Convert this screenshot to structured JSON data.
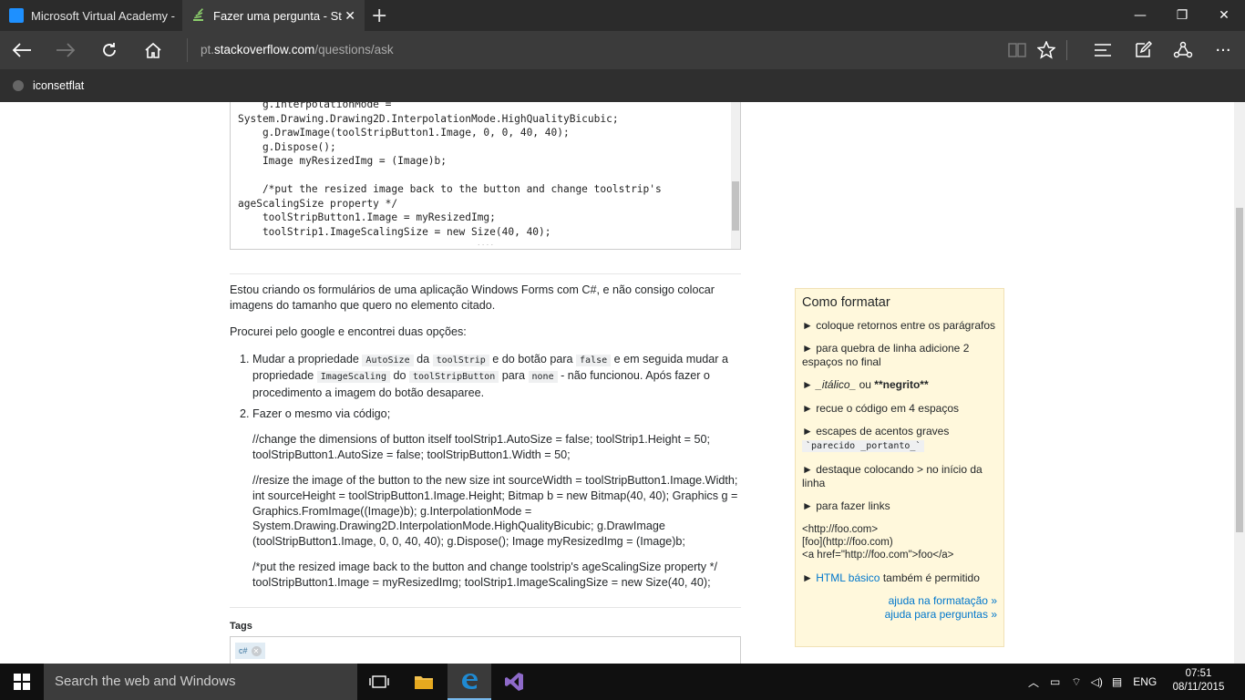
{
  "browser": {
    "tabs": [
      {
        "title": "Microsoft Virtual Academy -",
        "active": false
      },
      {
        "title": "Fazer uma pergunta - St",
        "active": true
      }
    ],
    "url_host": "pt.stackoverflow.com",
    "url_prefix": "pt.",
    "url_domain": "stackoverflow.com",
    "url_path": "/questions/ask",
    "favorites": [
      {
        "label": "iconsetflat"
      }
    ]
  },
  "editor": {
    "code_text": "    g.InterpolationMode = \nSystem.Drawing.Drawing2D.InterpolationMode.HighQualityBicubic;\n    g.DrawImage(toolStripButton1.Image, 0, 0, 40, 40);\n    g.Dispose();\n    Image myResizedImg = (Image)b;\n\n    /*put the resized image back to the button and change toolstrip's \nageScalingSize property */\n    toolStripButton1.Image = myResizedImg;\n    toolStrip1.ImageScalingSize = new Size(40, 40);"
  },
  "preview": {
    "para1": "Estou criando os formulários de uma aplicação Windows Forms com C#, e não consigo colocar imagens do tamanho que quero no elemento citado.",
    "para2": "Procurei pelo google e encontrei duas opções:",
    "item1": {
      "t1": "Mudar a propriedade ",
      "c1": "AutoSize",
      "t2": " da ",
      "c2": "toolStrip",
      "t3": " e do botão para ",
      "c3": "false",
      "t4": " e em seguida mudar a propriedade ",
      "c4": "ImageScaling",
      "t5": " do ",
      "c5": "toolStripButton",
      "t6": " para ",
      "c6": "none",
      "t7": " - não funcionou. Após fazer o procedimento a imagem do botão desaparee."
    },
    "item2": {
      "title": "Fazer o mesmo via código;",
      "p1": "//change the dimensions of button itself toolStrip1.AutoSize = false; toolStrip1.Height = 50; toolStripButton1.AutoSize = false; toolStripButton1.Width = 50;",
      "p2": "//resize the image of the button to the new size int sourceWidth = toolStripButton1.Image.Width; int sourceHeight = toolStripButton1.Image.Height; Bitmap b = new Bitmap(40, 40); Graphics g = Graphics.FromImage((Image)b); g.InterpolationMode = System.Drawing.Drawing2D.InterpolationMode.HighQualityBicubic; g.DrawImage (toolStripButton1.Image, 0, 0, 40, 40); g.Dispose(); Image myResizedImg = (Image)b;",
      "p3": "/*put the resized image back to the button and change toolstrip's ageScalingSize property */ toolStripButton1.Image = myResizedImg; toolStrip1.ImageScalingSize = new Size(40, 40);"
    }
  },
  "tags": {
    "label": "Tags",
    "items": [
      "c#"
    ]
  },
  "sidebar": {
    "title": "Como formatar",
    "bullet": "►",
    "items": [
      "coloque retornos entre os parágrafos",
      "para quebra de linha adicione 2 espaços no final"
    ],
    "italic_a": "_itálico_",
    "italic_b": " ou ",
    "bold": "**negrito**",
    "item4": "recue o código em 4 espaços",
    "item5": "escapes de acentos graves",
    "item5_code": "`parecido _portanto_`",
    "item6": "destaque colocando > no início da linha",
    "item7": "para fazer links",
    "link_examples": [
      "<http://foo.com>",
      "[foo](http://foo.com)",
      "<a href=\"http://foo.com\">foo</a>"
    ],
    "html_link": "HTML básico",
    "html_rest": " também é permitido",
    "help1": "ajuda na formatação »",
    "help2": "ajuda para perguntas »"
  },
  "taskbar": {
    "search_placeholder": "Search the web and Windows",
    "lang": "ENG",
    "time": "07:51",
    "date": "08/11/2015"
  },
  "colors": {
    "titlebar": "#2b2b2b",
    "navbar": "#3b3b3b",
    "sidebar_bg": "#fff8dc",
    "link": "#0077cc",
    "taskbar": "#101010"
  }
}
